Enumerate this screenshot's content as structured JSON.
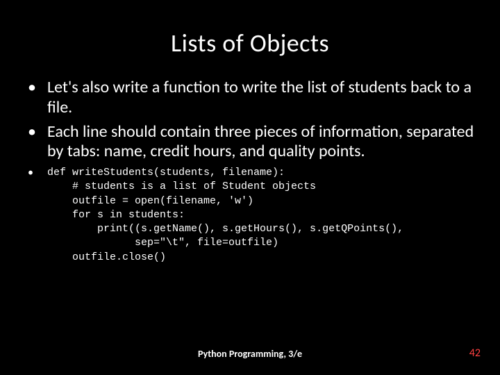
{
  "title": "Lists of Objects",
  "bullets": [
    "Let's also write a function to write the list of students back to a file.",
    "Each line should contain three pieces of information, separated by tabs: name, credit hours, and quality points."
  ],
  "code": "def writeStudents(students, filename):\n    # students is a list of Student objects\n    outfile = open(filename, 'w')\n    for s in students:\n        print((s.getName(), s.getHours(), s.getQPoints(),\n              sep=\"\\t\", file=outfile)\n    outfile.close()",
  "footer": "Python Programming, 3/e",
  "page_number": "42"
}
